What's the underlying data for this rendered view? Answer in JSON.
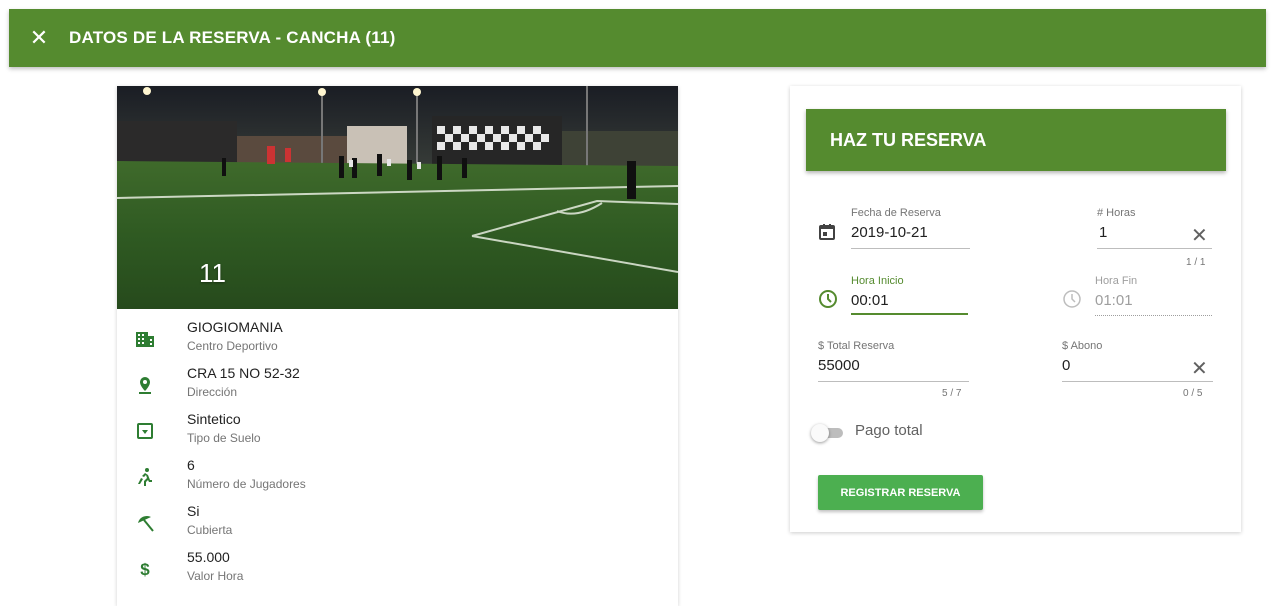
{
  "toolbar": {
    "close_icon": "close-icon",
    "title": "DATOS DE LA RESERVA - CANCHA (11)"
  },
  "venue": {
    "photo_number": "11",
    "details": [
      {
        "icon": "building-icon",
        "value": "GIOGIOMANIA",
        "label": "Centro Deportivo"
      },
      {
        "icon": "location-pin-icon",
        "value": "CRA 15 NO 52-32",
        "label": "Dirección"
      },
      {
        "icon": "flooring-icon",
        "value": "Sintetico",
        "label": "Tipo de Suelo"
      },
      {
        "icon": "running-person-icon",
        "value": "6",
        "label": "Número de Jugadores"
      },
      {
        "icon": "beach-umbrella-icon",
        "value": "Si",
        "label": "Cubierta"
      },
      {
        "icon": "dollar-icon",
        "value": "55.000",
        "label": "Valor Hora"
      }
    ]
  },
  "booking": {
    "header": "HAZ TU RESERVA",
    "fecha": {
      "label": "Fecha de Reserva",
      "value": "2019-10-21",
      "icon": "calendar-icon"
    },
    "horas": {
      "label": "# Horas",
      "value": "1",
      "counter": "1 / 1",
      "clear_icon": "close-icon"
    },
    "hora_inicio": {
      "label": "Hora Inicio",
      "value": "00:01",
      "icon": "clock-icon"
    },
    "hora_fin": {
      "label": "Hora Fin",
      "value": "01:01",
      "icon": "clock-icon"
    },
    "total": {
      "label": "$ Total Reserva",
      "value": "55000",
      "counter": "5 / 7"
    },
    "abono": {
      "label": "$ Abono",
      "value": "0",
      "counter": "0 / 5",
      "clear_icon": "close-icon"
    },
    "pago_total": {
      "label": "Pago total",
      "checked": false
    },
    "submit_label": "REGISTRAR RESERVA"
  },
  "colors": {
    "primary": "#558b2f",
    "button": "#4caf50",
    "icon_green": "#2e7d32"
  }
}
